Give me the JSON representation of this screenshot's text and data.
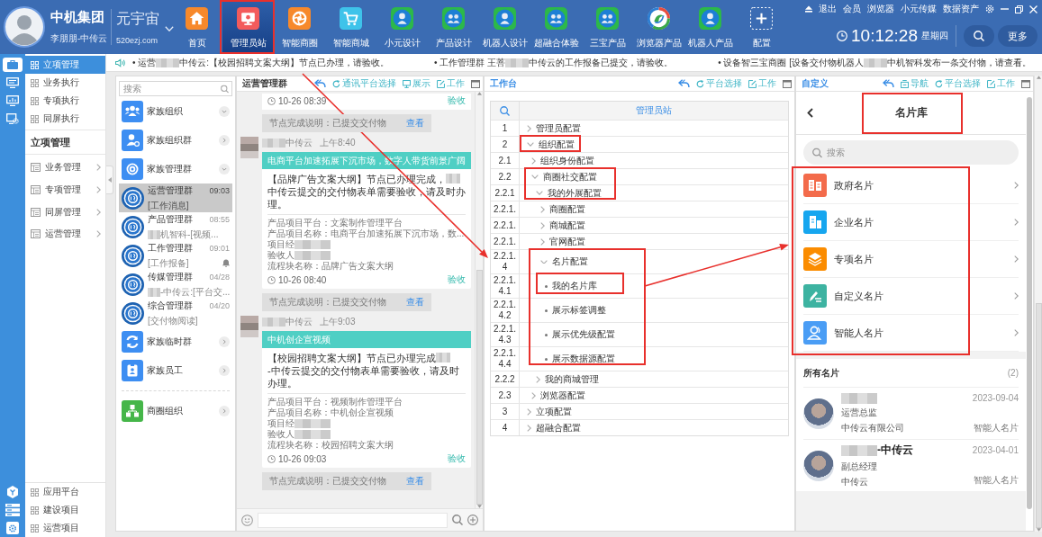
{
  "header": {
    "org_name": "中机集团",
    "user_name": "李朋朋-中传云",
    "space_name": "元宇宙",
    "space_domain": "520ezj.com",
    "apps": [
      {
        "label": "首页",
        "selected": false
      },
      {
        "label": "管理员站",
        "selected": true
      },
      {
        "label": "智能商圈",
        "selected": false
      },
      {
        "label": "智能商城",
        "selected": false
      },
      {
        "label": "小元设计",
        "selected": false
      },
      {
        "label": "产品设计",
        "selected": false
      },
      {
        "label": "机器人设计",
        "selected": false
      },
      {
        "label": "超融合体验",
        "selected": false
      },
      {
        "label": "三宝产品",
        "selected": false
      },
      {
        "label": "浏览器产品",
        "selected": false
      },
      {
        "label": "机器人产品",
        "selected": false
      }
    ],
    "add_app": "配置",
    "links": [
      "退出",
      "会员",
      "浏览器",
      "小元传媒",
      "数据资产"
    ],
    "time": "10:12:28",
    "weekday": "星期四",
    "more": "更多"
  },
  "sidebar": {
    "top_items": [
      {
        "label": "立项管理",
        "selected": true
      },
      {
        "label": "业务执行",
        "selected": false
      },
      {
        "label": "专项执行",
        "selected": false
      },
      {
        "label": "同屏执行",
        "selected": false
      }
    ],
    "section_title": "立项管理",
    "section_items": [
      "业务管理",
      "专项管理",
      "同屏管理",
      "运营管理"
    ],
    "bottom_items": [
      "应用平台",
      "建设项目",
      "运营项目"
    ]
  },
  "ticker": [
    {
      "parts": [
        {
          "kind": "text",
          "text": "• 运营"
        },
        {
          "kind": "redacted"
        },
        {
          "kind": "text",
          "text": "中传云:【校园招聘文案大纲】节点已办理，请验收。"
        }
      ]
    },
    {
      "parts": [
        {
          "kind": "text",
          "text": "• 工作管理群 王菩"
        },
        {
          "kind": "redacted"
        },
        {
          "kind": "text",
          "text": "中传云的工作报备已提交，请验收。"
        }
      ]
    },
    {
      "parts": [
        {
          "kind": "text",
          "text": "• 设备智三宝商圈 [设备交付物机器人"
        },
        {
          "kind": "redacted"
        },
        {
          "kind": "text",
          "text": "中机智科发布一条交付物，请查看。"
        }
      ]
    }
  ],
  "chat_list": {
    "search_placeholder": "搜索",
    "items": [
      {
        "kind": "folder",
        "name": "家族组织",
        "expanded": true,
        "selected": false
      },
      {
        "kind": "folder",
        "name": "家族组织群",
        "expanded": false,
        "selected": false
      },
      {
        "kind": "folder",
        "name": "家族管理群",
        "expanded": true,
        "selected": false
      },
      {
        "kind": "chat",
        "name": "运营管理群",
        "time": "09:03",
        "preview": [
          {
            "kind": "text",
            "text": "[工作消息]"
          }
        ],
        "muted": false,
        "selected": true
      },
      {
        "kind": "chat",
        "name": "产品管理群",
        "time": "08:55",
        "preview": [
          {
            "kind": "redacted"
          },
          {
            "kind": "text",
            "text": "机智科-[视频..."
          }
        ],
        "muted": false,
        "selected": false
      },
      {
        "kind": "chat",
        "name": "工作管理群",
        "time": "09:01",
        "preview": [
          {
            "kind": "text",
            "text": "[工作报备]"
          }
        ],
        "muted": true,
        "selected": false
      },
      {
        "kind": "chat",
        "name": "传媒管理群",
        "time": "04/28",
        "preview": [
          {
            "kind": "redacted"
          },
          {
            "kind": "text",
            "text": "-中传云:[平台交..."
          }
        ],
        "muted": false,
        "selected": false
      },
      {
        "kind": "chat",
        "name": "综合管理群",
        "time": "04/20",
        "preview": [
          {
            "kind": "text",
            "text": "[交付物阅读]"
          }
        ],
        "muted": false,
        "selected": false
      },
      {
        "kind": "folder",
        "name": "家族临时群",
        "expanded": false,
        "selected": false
      },
      {
        "kind": "folder",
        "name": "家族员工",
        "expanded": false,
        "selected": false
      }
    ],
    "org_items": [
      {
        "name": "商圈组织",
        "expanded": false
      }
    ]
  },
  "chat": {
    "title": "运营管理群",
    "actions": [
      "通讯平台选择",
      "展示",
      "工作"
    ],
    "messages": [
      {
        "kind": "tail",
        "stamp": "10-26 08:39",
        "action": "验收"
      },
      {
        "kind": "notice",
        "text": "节点完成说明：已提交交付物",
        "link": "查看"
      },
      {
        "kind": "card",
        "sender": [
          {
            "kind": "redacted"
          },
          {
            "kind": "text",
            "text": "中传云"
          }
        ],
        "time": "上午8:40",
        "title": "电商平台加速拓展下沉市场，数字人带货前景广阔",
        "body": [
          {
            "kind": "text",
            "text": "【品牌广告文案大纲】节点已办理完成，"
          },
          {
            "kind": "redacted"
          },
          {
            "kind": "text",
            "text": "中传云提交的交付物表单需要验收，请及时办理。"
          }
        ],
        "details": [
          [
            {
              "kind": "text",
              "text": "产品项目平台：文案制作管理平台"
            }
          ],
          [
            {
              "kind": "text",
              "text": "产品项目名称：电商平台加速拓展下沉市场，数..."
            }
          ],
          [
            {
              "kind": "text",
              "text": "项目经"
            },
            {
              "kind": "redacted"
            }
          ],
          [
            {
              "kind": "text",
              "text": "验收人"
            },
            {
              "kind": "redacted"
            }
          ],
          [
            {
              "kind": "text",
              "text": "流程块名称：品牌广告文案大纲"
            }
          ]
        ],
        "stamp": "10-26 08:40",
        "action": "验收"
      },
      {
        "kind": "notice",
        "text": "节点完成说明：已提交交付物",
        "link": "查看"
      },
      {
        "kind": "card",
        "sender": [
          {
            "kind": "redacted"
          },
          {
            "kind": "text",
            "text": "中传云"
          }
        ],
        "time": "上午9:03",
        "title": "中机创企宣视频",
        "body": [
          {
            "kind": "text",
            "text": "【校园招聘文案大纲】节点已办理完成"
          },
          {
            "kind": "redacted"
          },
          {
            "kind": "text",
            "text": "-中传云提交的交付物表单需要验收，请及时办理。"
          }
        ],
        "details": [
          [
            {
              "kind": "text",
              "text": "产品项目平台：视频制作管理平台"
            }
          ],
          [
            {
              "kind": "text",
              "text": "产品项目名称：中机创企宣视频"
            }
          ],
          [
            {
              "kind": "text",
              "text": "项目经"
            },
            {
              "kind": "redacted"
            }
          ],
          [
            {
              "kind": "text",
              "text": "验收人"
            },
            {
              "kind": "redacted"
            }
          ],
          [
            {
              "kind": "text",
              "text": "流程块名称：校园招聘文案大纲"
            }
          ]
        ],
        "stamp": "10-26 09:03",
        "action": "验收"
      },
      {
        "kind": "notice",
        "text": "节点完成说明：已提交交付物",
        "link": "查看"
      }
    ]
  },
  "workspace": {
    "title": "工作台",
    "actions": [
      "平台选择",
      "工作"
    ],
    "tree_heading": "管理员站",
    "tree": [
      {
        "number": "1",
        "label": "管理员配置",
        "kind": "branch",
        "expanded": false
      },
      {
        "number": "2",
        "label": "组织配置",
        "kind": "branch",
        "expanded": true,
        "children": [
          {
            "number": "2.1",
            "label": "组织身份配置",
            "kind": "branch",
            "expanded": false
          },
          {
            "number": "2.2",
            "label": "商圈社交配置",
            "kind": "branch",
            "expanded": true,
            "children": [
              {
                "number": "2.2.1",
                "label": "我的外展配置",
                "kind": "branch",
                "expanded": true,
                "children": [
                  {
                    "number": "2.2.1.",
                    "label": "商圈配置",
                    "kind": "branch",
                    "expanded": false
                  },
                  {
                    "number": "2.2.1.",
                    "label": "商城配置",
                    "kind": "branch",
                    "expanded": false
                  },
                  {
                    "number": "2.2.1.",
                    "label": "官网配置",
                    "kind": "branch",
                    "expanded": false
                  },
                  {
                    "number": "2.2.1.4",
                    "label": "名片配置",
                    "kind": "branch",
                    "expanded": true,
                    "children": [
                      {
                        "number": "2.2.1.4.1",
                        "label": "我的名片库",
                        "kind": "leaf"
                      },
                      {
                        "number": "2.2.1.4.2",
                        "label": "展示标签调整",
                        "kind": "leaf"
                      },
                      {
                        "number": "2.2.1.4.3",
                        "label": "展示优先级配置",
                        "kind": "leaf"
                      },
                      {
                        "number": "2.2.1.4.4",
                        "label": "展示数据源配置",
                        "kind": "leaf"
                      }
                    ]
                  }
                ]
              },
              {
                "number": "2.2.2",
                "label": "我的商城管理",
                "kind": "branch",
                "expanded": false
              }
            ]
          },
          {
            "number": "2.3",
            "label": "浏览器配置",
            "kind": "branch",
            "expanded": false
          }
        ]
      },
      {
        "number": "3",
        "label": "立项配置",
        "kind": "branch",
        "expanded": false
      },
      {
        "number": "4",
        "label": "超融合配置",
        "kind": "branch",
        "expanded": false
      }
    ]
  },
  "card_library": {
    "panel_title": "自定义",
    "actions": [
      "导航",
      "平台选择",
      "工作"
    ],
    "title": "名片库",
    "search_placeholder": "搜索",
    "categories": [
      {
        "label": "政府名片",
        "color": "#f36b4b"
      },
      {
        "label": "企业名片",
        "color": "#16a6ef"
      },
      {
        "label": "专项名片",
        "color": "#fb8c00"
      },
      {
        "label": "自定义名片",
        "color": "#3db3a1"
      },
      {
        "label": "智能人名片",
        "color": "#4a9df5"
      }
    ],
    "all_title": "所有名片",
    "count": "(2)",
    "cards": [
      {
        "name": [
          {
            "kind": "redacted"
          }
        ],
        "role": "运营总监",
        "company": "中传云有限公司",
        "date": "2023-09-04",
        "tag": "智能人名片"
      },
      {
        "name": [
          {
            "kind": "redacted"
          },
          {
            "kind": "text",
            "text": "-中传云"
          }
        ],
        "role": "副总经理",
        "company": "中传云",
        "date": "2023-04-01",
        "tag": "智能人名片"
      }
    ]
  }
}
